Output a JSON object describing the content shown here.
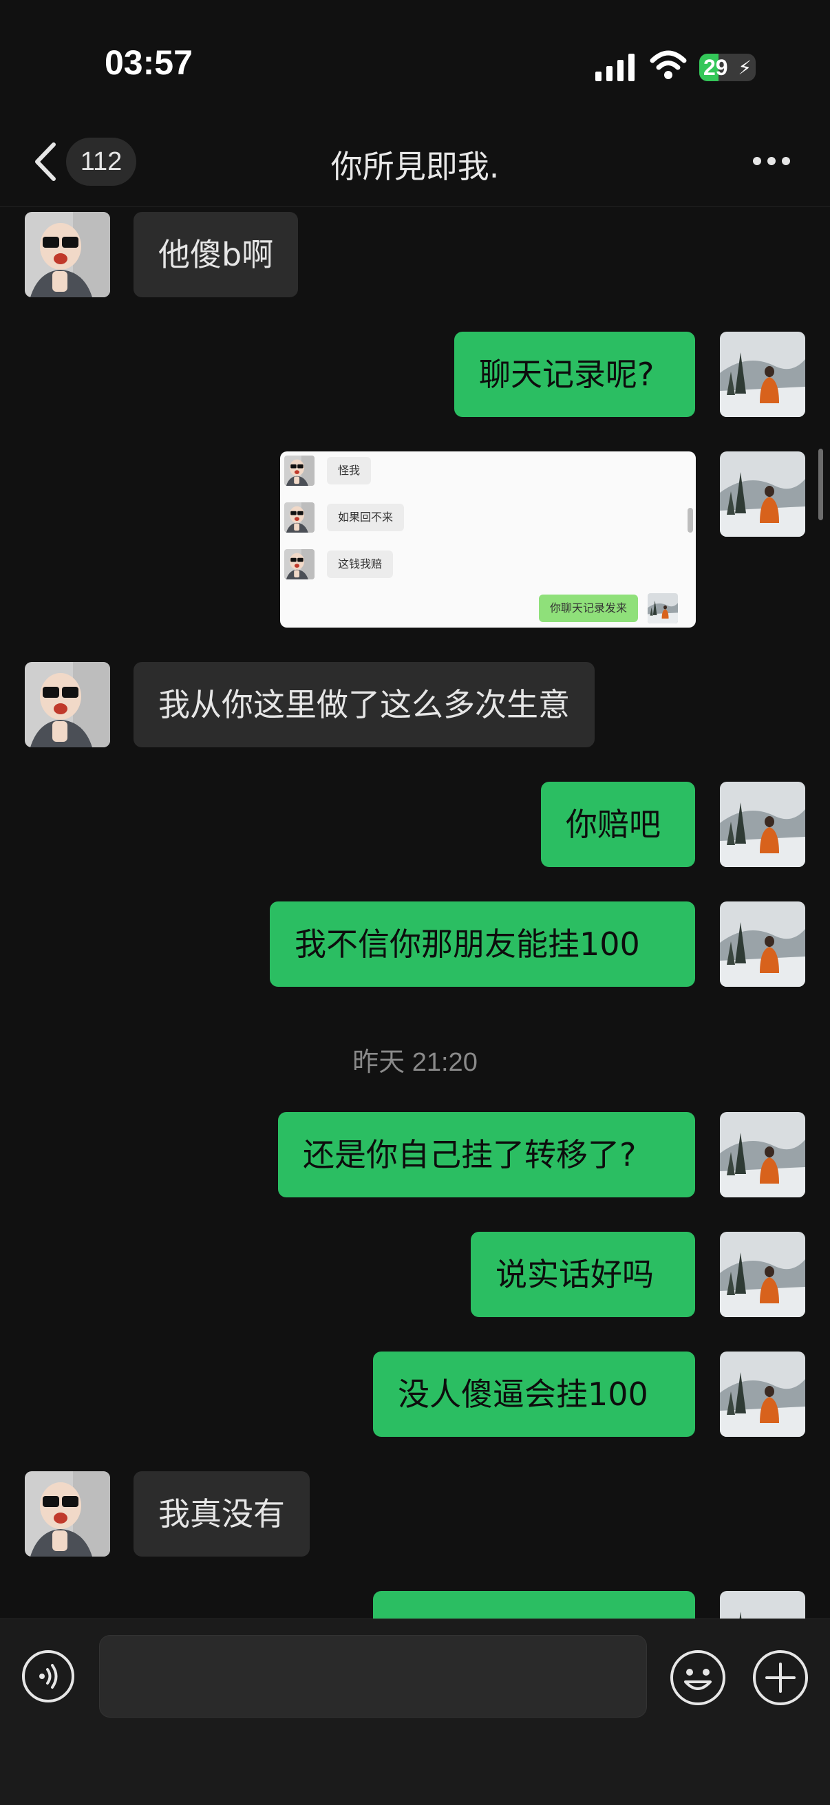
{
  "status_bar": {
    "time": "03:57",
    "battery": "29"
  },
  "header": {
    "back_count": "112",
    "title": "你所見即我."
  },
  "messages": [
    {
      "side": "in",
      "text": "他傻b啊"
    },
    {
      "side": "out",
      "text": "聊天记录呢?"
    },
    {
      "side": "out",
      "type": "image"
    },
    {
      "side": "in",
      "text": "我从你这里做了这么多次生意"
    },
    {
      "side": "out",
      "text": "你赔吧"
    },
    {
      "side": "out",
      "text": "我不信你那朋友能挂100"
    },
    {
      "side": "out",
      "text": "还是你自己挂了转移了?"
    },
    {
      "side": "out",
      "text": "说实话好吗"
    },
    {
      "side": "out",
      "text": "没人傻逼会挂100"
    },
    {
      "side": "in",
      "text": "我真没有"
    }
  ],
  "timestamp": "昨天 21:20",
  "image_message": {
    "rows": [
      {
        "side": "in",
        "text": "怪我"
      },
      {
        "side": "in",
        "text": "如果回不来"
      },
      {
        "side": "in",
        "text": "这钱我赔"
      },
      {
        "side": "out",
        "text": "你聊天记录发来"
      }
    ]
  },
  "input": {
    "placeholder": ""
  },
  "colors": {
    "background": "#111111",
    "incoming_bubble": "#2c2c2c",
    "outgoing_bubble": "#2bbe62",
    "input_bar": "#1b1b1b"
  },
  "icons": [
    "back-icon",
    "more-icon",
    "voice-icon",
    "emoji-icon",
    "plus-icon",
    "signal-icon",
    "wifi-icon",
    "battery-icon"
  ]
}
